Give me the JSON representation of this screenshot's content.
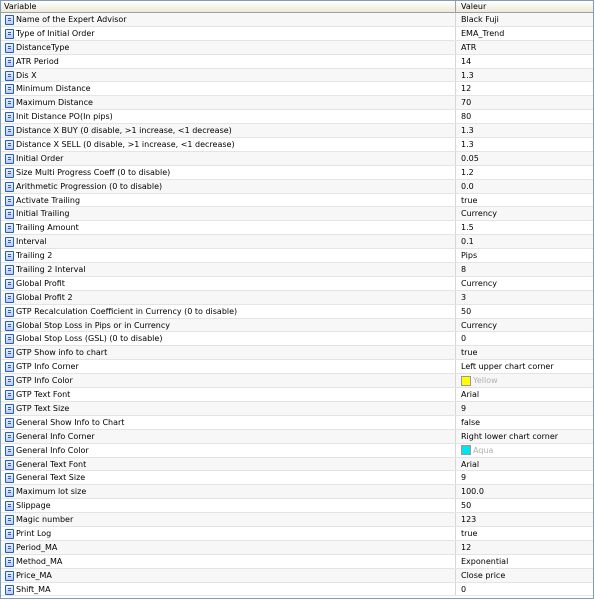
{
  "header": {
    "variable": "Variable",
    "value": "Valeur"
  },
  "colors": {
    "Yellow": "#ffff00",
    "Aqua": "#00e5ee"
  },
  "rows": [
    {
      "name": "Name of the Expert Advisor",
      "value": "Black Fuji"
    },
    {
      "name": "Type of Initial Order",
      "value": "EMA_Trend"
    },
    {
      "name": "DistanceType",
      "value": "ATR"
    },
    {
      "name": "ATR Period",
      "value": "14"
    },
    {
      "name": "Dis X",
      "value": "1.3"
    },
    {
      "name": "Minimum Distance",
      "value": "12"
    },
    {
      "name": "Maximum Distance",
      "value": "70"
    },
    {
      "name": "Init Distance PO(In pips)",
      "value": "80"
    },
    {
      "name": "Distance X BUY (0 disable, >1 increase, <1 decrease)",
      "value": "1.3"
    },
    {
      "name": "Distance X SELL (0 disable, >1 increase, <1 decrease)",
      "value": "1.3"
    },
    {
      "name": "Initial Order",
      "value": "0.05"
    },
    {
      "name": "Size Multi Progress Coeff (0 to disable)",
      "value": "1.2"
    },
    {
      "name": "Arithmetic Progression (0 to disable)",
      "value": "0.0"
    },
    {
      "name": "Activate Trailing",
      "value": "true"
    },
    {
      "name": "Initial Trailing",
      "value": "Currency"
    },
    {
      "name": "Trailing Amount",
      "value": "1.5"
    },
    {
      "name": "Interval",
      "value": "0.1"
    },
    {
      "name": "Trailing 2",
      "value": "Pips"
    },
    {
      "name": "Trailing 2 Interval",
      "value": "8"
    },
    {
      "name": "Global Profit",
      "value": "Currency"
    },
    {
      "name": "Global Profit 2",
      "value": "3"
    },
    {
      "name": "GTP Recalculation Coefficient in Currency (0 to disable)",
      "value": "50"
    },
    {
      "name": "Global Stop Loss in Pips or in Currency",
      "value": "Currency"
    },
    {
      "name": "Global Stop Loss (GSL) (0 to disable)",
      "value": "0"
    },
    {
      "name": "GTP Show info to chart",
      "value": "true"
    },
    {
      "name": "GTP Info Corner",
      "value": "Left upper chart corner"
    },
    {
      "name": "GTP Info Color",
      "value": "Yellow",
      "swatch": "Yellow"
    },
    {
      "name": "GTP Text Font",
      "value": "Arial"
    },
    {
      "name": "GTP Text Size",
      "value": "9"
    },
    {
      "name": "General Show Info to Chart",
      "value": "false"
    },
    {
      "name": "General Info Corner",
      "value": "Right lower chart corner"
    },
    {
      "name": "General Info Color",
      "value": "Aqua",
      "swatch": "Aqua"
    },
    {
      "name": "General Text Font",
      "value": "Arial"
    },
    {
      "name": "General Text Size",
      "value": "9"
    },
    {
      "name": "Maximum lot size",
      "value": "100.0"
    },
    {
      "name": "Slippage",
      "value": "50"
    },
    {
      "name": "Magic number",
      "value": "123"
    },
    {
      "name": "Print Log",
      "value": "true"
    },
    {
      "name": "Period_MA",
      "value": "12"
    },
    {
      "name": "Method_MA",
      "value": "Exponential"
    },
    {
      "name": "Price_MA",
      "value": "Close price"
    },
    {
      "name": "Shift_MA",
      "value": "0"
    }
  ]
}
